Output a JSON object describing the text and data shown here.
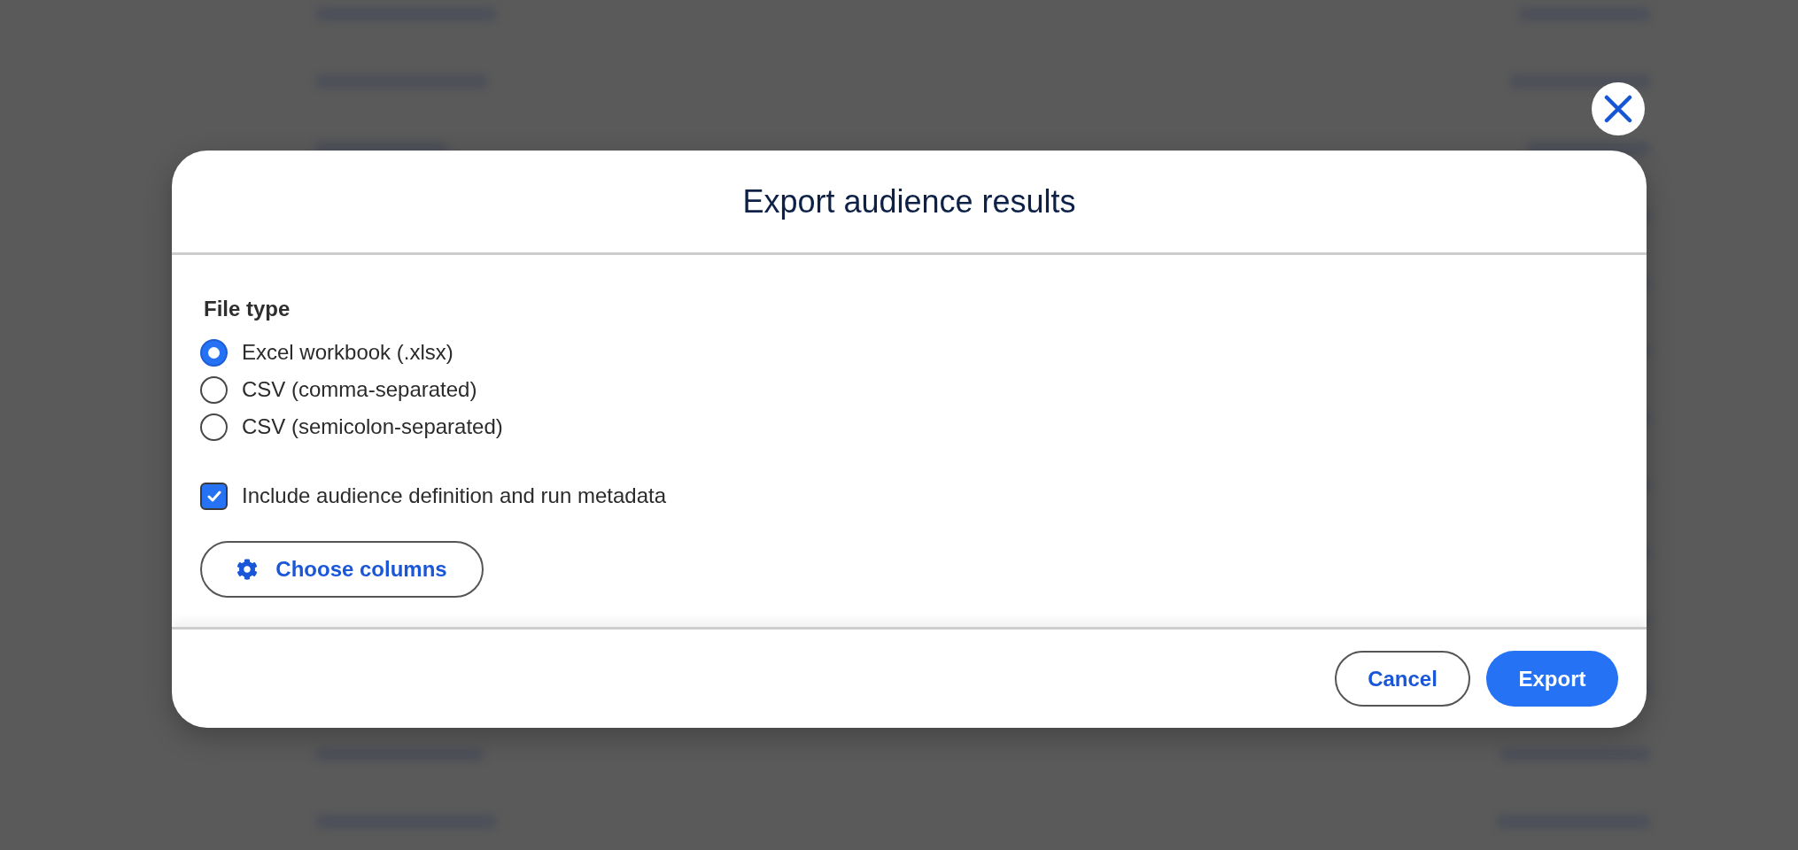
{
  "dialog": {
    "title": "Export audience results",
    "file_type": {
      "label": "File type",
      "options": [
        {
          "label": "Excel workbook (.xlsx)",
          "selected": true
        },
        {
          "label": "CSV (comma-separated)",
          "selected": false
        },
        {
          "label": "CSV (semicolon-separated)",
          "selected": false
        }
      ]
    },
    "include_metadata": {
      "label": "Include audience definition and run metadata",
      "checked": true
    },
    "choose_columns_button": {
      "label": "Choose columns"
    },
    "buttons": [
      {
        "label": "Cancel",
        "kind": "secondary"
      },
      {
        "label": "Export",
        "kind": "primary"
      }
    ]
  }
}
